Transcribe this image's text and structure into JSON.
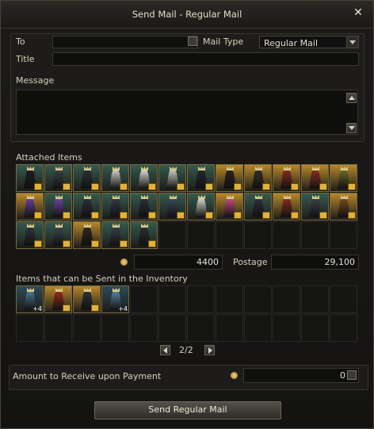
{
  "window": {
    "title": "Send Mail - Regular Mail",
    "close_glyph": "✕"
  },
  "form": {
    "to_label": "To",
    "to_value": "",
    "mail_type_label": "Mail Type",
    "mail_type_value": "Regular Mail",
    "title_label": "Title",
    "title_value": "",
    "message_label": "Message",
    "message_value": ""
  },
  "attached": {
    "label": "Attached Items",
    "items": [
      {
        "bg": "#365a4e",
        "robe": "#1d1f22",
        "icon": "dark-robe-icon"
      },
      {
        "bg": "#365a4e",
        "robe": "#3a4048",
        "icon": "dark-robe-icon"
      },
      {
        "bg": "#365a4e",
        "robe": "#2b3036",
        "icon": "dark-robe-icon"
      },
      {
        "bg": "#365a4e",
        "robe": "#cfd3c8",
        "icon": "white-robe-icon"
      },
      {
        "bg": "#365a4e",
        "robe": "#d9dcd0",
        "icon": "white-robe-icon"
      },
      {
        "bg": "#365a4e",
        "robe": "#c7ccc4",
        "icon": "white-robe-icon"
      },
      {
        "bg": "#365a4e",
        "robe": "#25292e",
        "icon": "dark-robe-icon"
      },
      {
        "bg": "#b7872a",
        "robe": "#2a2520",
        "icon": "dark-robe-icon"
      },
      {
        "bg": "#b7872a",
        "robe": "#3a2e28",
        "icon": "dark-robe-icon"
      },
      {
        "bg": "#b7872a",
        "robe": "#8a2b1e",
        "icon": "red-robe-icon"
      },
      {
        "bg": "#b7872a",
        "robe": "#8a2f20",
        "icon": "red-robe-icon"
      },
      {
        "bg": "#b7872a",
        "robe": "#6a6a2a",
        "icon": "olive-robe-icon"
      },
      {
        "bg": "#b7872a",
        "robe": "#6a3fa0",
        "icon": "purple-robe-icon"
      },
      {
        "bg": "#365a4e",
        "robe": "#6d45a8",
        "icon": "purple-robe-icon"
      },
      {
        "bg": "#365a4e",
        "robe": "#2c3137",
        "icon": "dark-robe-icon"
      },
      {
        "bg": "#365a4e",
        "robe": "#343a42",
        "icon": "dark-robe-icon"
      },
      {
        "bg": "#365a4e",
        "robe": "#2a3038",
        "icon": "dark-robe-icon"
      },
      {
        "bg": "#365a4e",
        "robe": "#3a4a5a",
        "icon": "blue-robe-icon"
      },
      {
        "bg": "#365a4e",
        "robe": "#d6d6cc",
        "icon": "white-robe-icon"
      },
      {
        "bg": "#b7872a",
        "robe": "#c94a8a",
        "icon": "pink-robe-icon"
      },
      {
        "bg": "#365a4e",
        "robe": "#2d3238",
        "icon": "dark-robe-icon"
      },
      {
        "bg": "#b7872a",
        "robe": "#8c2a22",
        "icon": "red-robe-icon"
      },
      {
        "bg": "#365a4e",
        "robe": "#3a4048",
        "icon": "dark-robe-icon"
      },
      {
        "bg": "#b7872a",
        "robe": "#7a4a22",
        "icon": "brown-robe-icon"
      },
      {
        "bg": "#365a4e",
        "robe": "#2f343a",
        "icon": "dark-robe-icon"
      },
      {
        "bg": "#365a4e",
        "robe": "#3d444c",
        "icon": "dark-robe-icon"
      },
      {
        "bg": "#b7872a",
        "robe": "#2c2622",
        "icon": "dark-robe-icon"
      },
      {
        "bg": "#365a4e",
        "robe": "#3a3f46",
        "icon": "dark-robe-icon"
      },
      {
        "bg": "#365a4e",
        "robe": "#2a2f35",
        "icon": "dark-robe-icon"
      }
    ],
    "empty_slots": 7,
    "fee_value": "4400",
    "postage_label": "Postage",
    "postage_value": "29,100"
  },
  "inventory": {
    "label": "Items that can be Sent in the Inventory",
    "items": [
      {
        "bg": "#2f4a56",
        "robe": "#4a7d90",
        "icon": "armor-icon",
        "plus": "+4"
      },
      {
        "bg": "#b7872a",
        "robe": "#9a2a1c",
        "icon": "red-robe-icon",
        "plus": ""
      },
      {
        "bg": "#b7872a",
        "robe": "#2c3138",
        "icon": "dark-robe-icon",
        "plus": ""
      },
      {
        "bg": "#2f4a56",
        "robe": "#5a86a0",
        "icon": "shield-armor-icon",
        "plus": "+4"
      }
    ],
    "empty_slots": 20,
    "page": "2/2"
  },
  "payment": {
    "label": "Amount to Receive upon Payment",
    "value": "0"
  },
  "send_button": "Send Regular Mail"
}
